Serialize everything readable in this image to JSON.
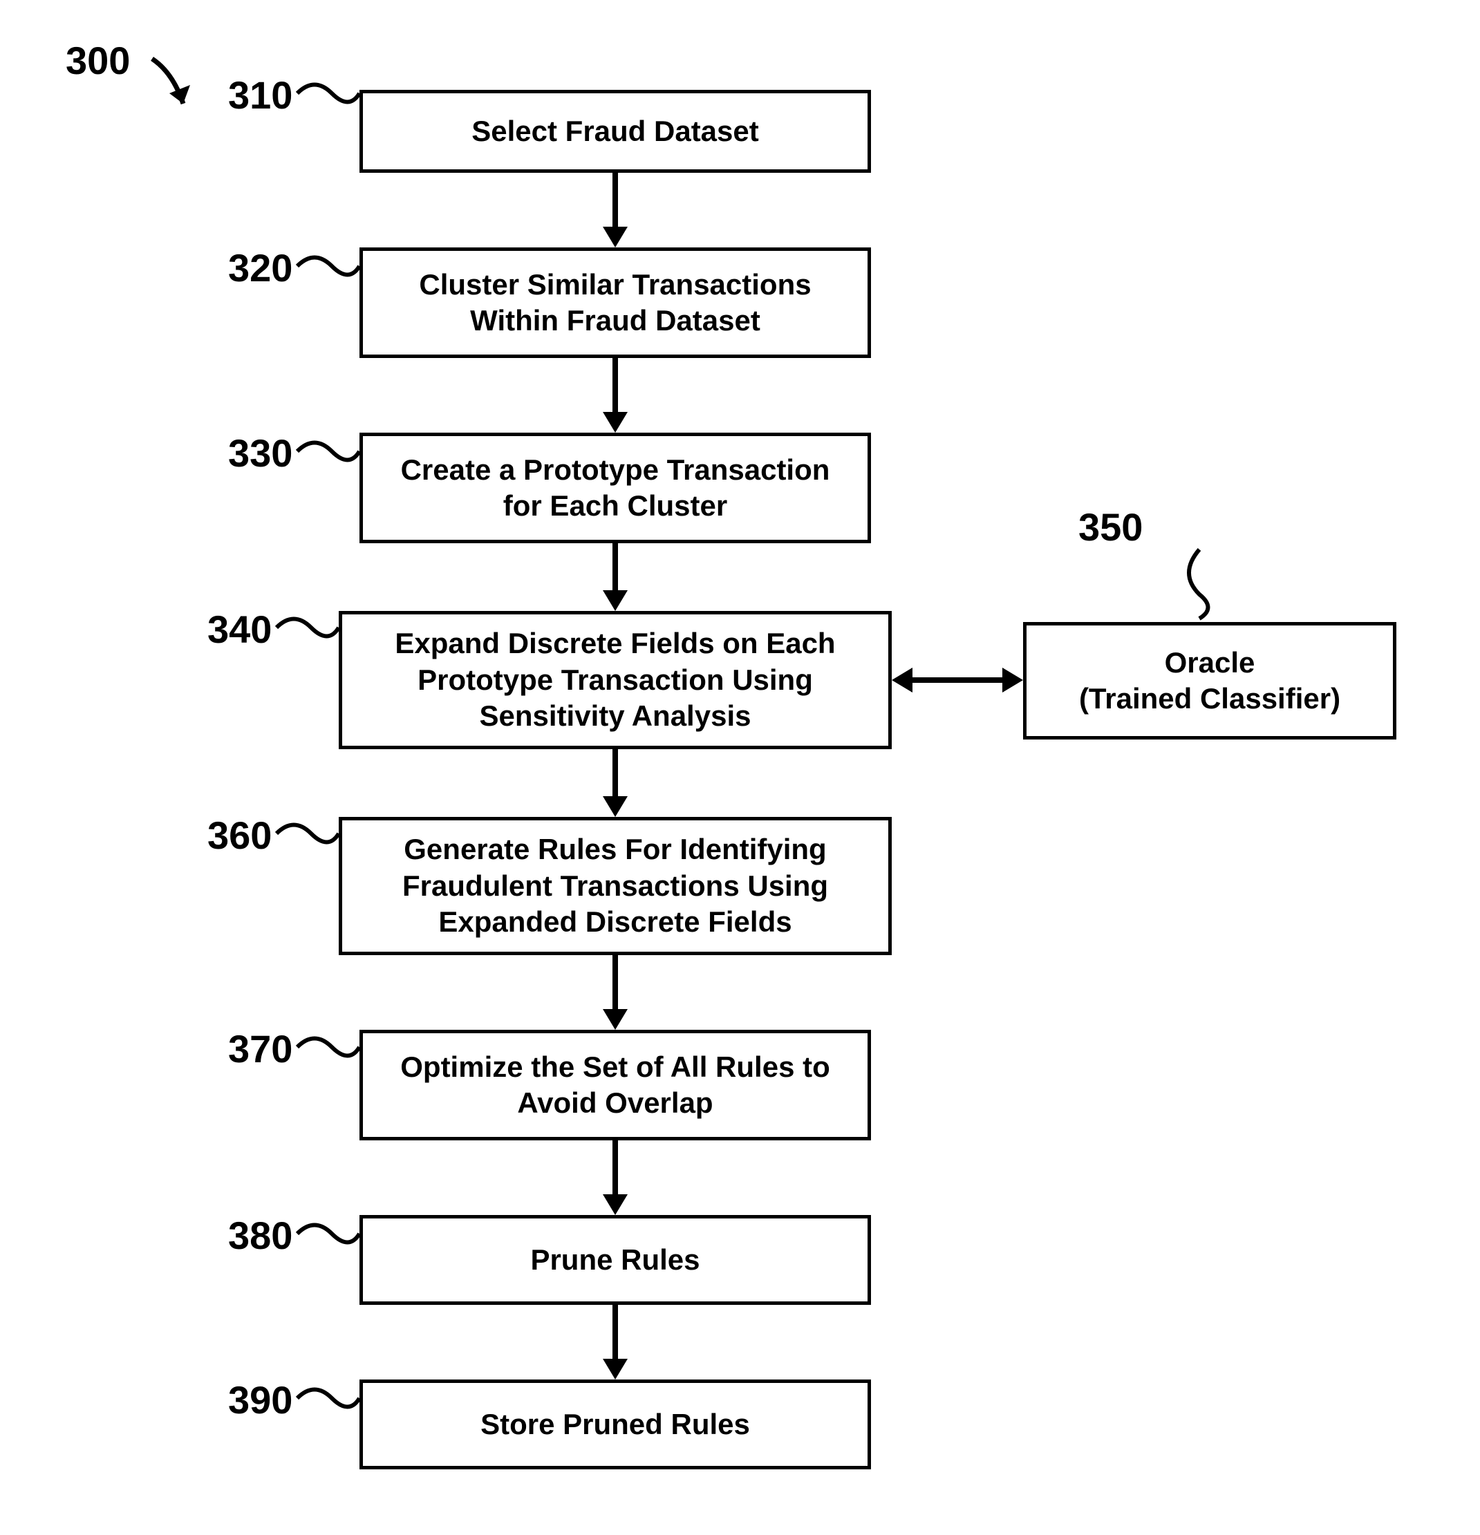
{
  "diagram_id": "300",
  "steps": {
    "s310": {
      "num": "310",
      "text": "Select Fraud Dataset"
    },
    "s320": {
      "num": "320",
      "text": "Cluster Similar Transactions Within Fraud Dataset"
    },
    "s330": {
      "num": "330",
      "text": "Create a Prototype Transaction for Each Cluster"
    },
    "s340": {
      "num": "340",
      "text": "Expand Discrete Fields on Each Prototype Transaction Using Sensitivity Analysis"
    },
    "s350": {
      "num": "350",
      "text": "Oracle\n(Trained Classifier)"
    },
    "s360": {
      "num": "360",
      "text": "Generate Rules For Identifying Fraudulent Transactions Using Expanded Discrete Fields"
    },
    "s370": {
      "num": "370",
      "text": "Optimize the Set of All Rules to Avoid Overlap"
    },
    "s380": {
      "num": "380",
      "text": "Prune Rules"
    },
    "s390": {
      "num": "390",
      "text": "Store Pruned Rules"
    }
  }
}
